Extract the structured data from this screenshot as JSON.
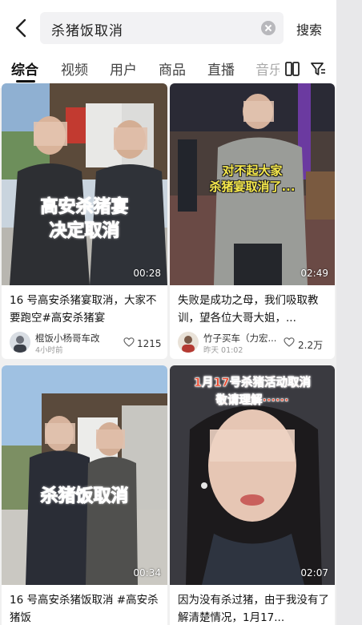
{
  "search": {
    "query": "杀猪饭取消",
    "button_label": "搜索"
  },
  "tabs": [
    {
      "label": "综合"
    },
    {
      "label": "视频"
    },
    {
      "label": "用户"
    },
    {
      "label": "商品"
    },
    {
      "label": "直播"
    },
    {
      "label": "音乐"
    }
  ],
  "colors": {
    "accent_red": "#e8452a",
    "overlay_yellow": "#f5e84a",
    "text_dark": "#111111"
  },
  "cards": [
    {
      "overlay_line1": "高安杀猪宴",
      "overlay_line2": "决定取消",
      "duration": "00:28",
      "title": "16 号高安杀猪宴取消，大家不要跑空#高安杀猪宴",
      "author": "棍饭小杨哥车改",
      "time": "4小时前",
      "likes": "1215"
    },
    {
      "overlay_line1": "对不起大家",
      "overlay_line2": "杀猪宴取消了...",
      "duration": "02:49",
      "title": "失败是成功之母，我们吸取教训，望各位大哥大姐，...",
      "author": "竹子买车（力宏...",
      "time": "昨天 01:02",
      "likes": "2.2万"
    },
    {
      "overlay_line1": "杀猪饭取消",
      "duration": "00:34",
      "title": "16 号高安杀猪饭取消 #高安杀猪饭"
    },
    {
      "overlay_line1": "1月17号杀猪活动取消",
      "overlay_line2": "敬请理解······",
      "duration": "02:07",
      "title": "因为没有杀过猪，由于我没有了解清楚情况，1月17..."
    }
  ]
}
